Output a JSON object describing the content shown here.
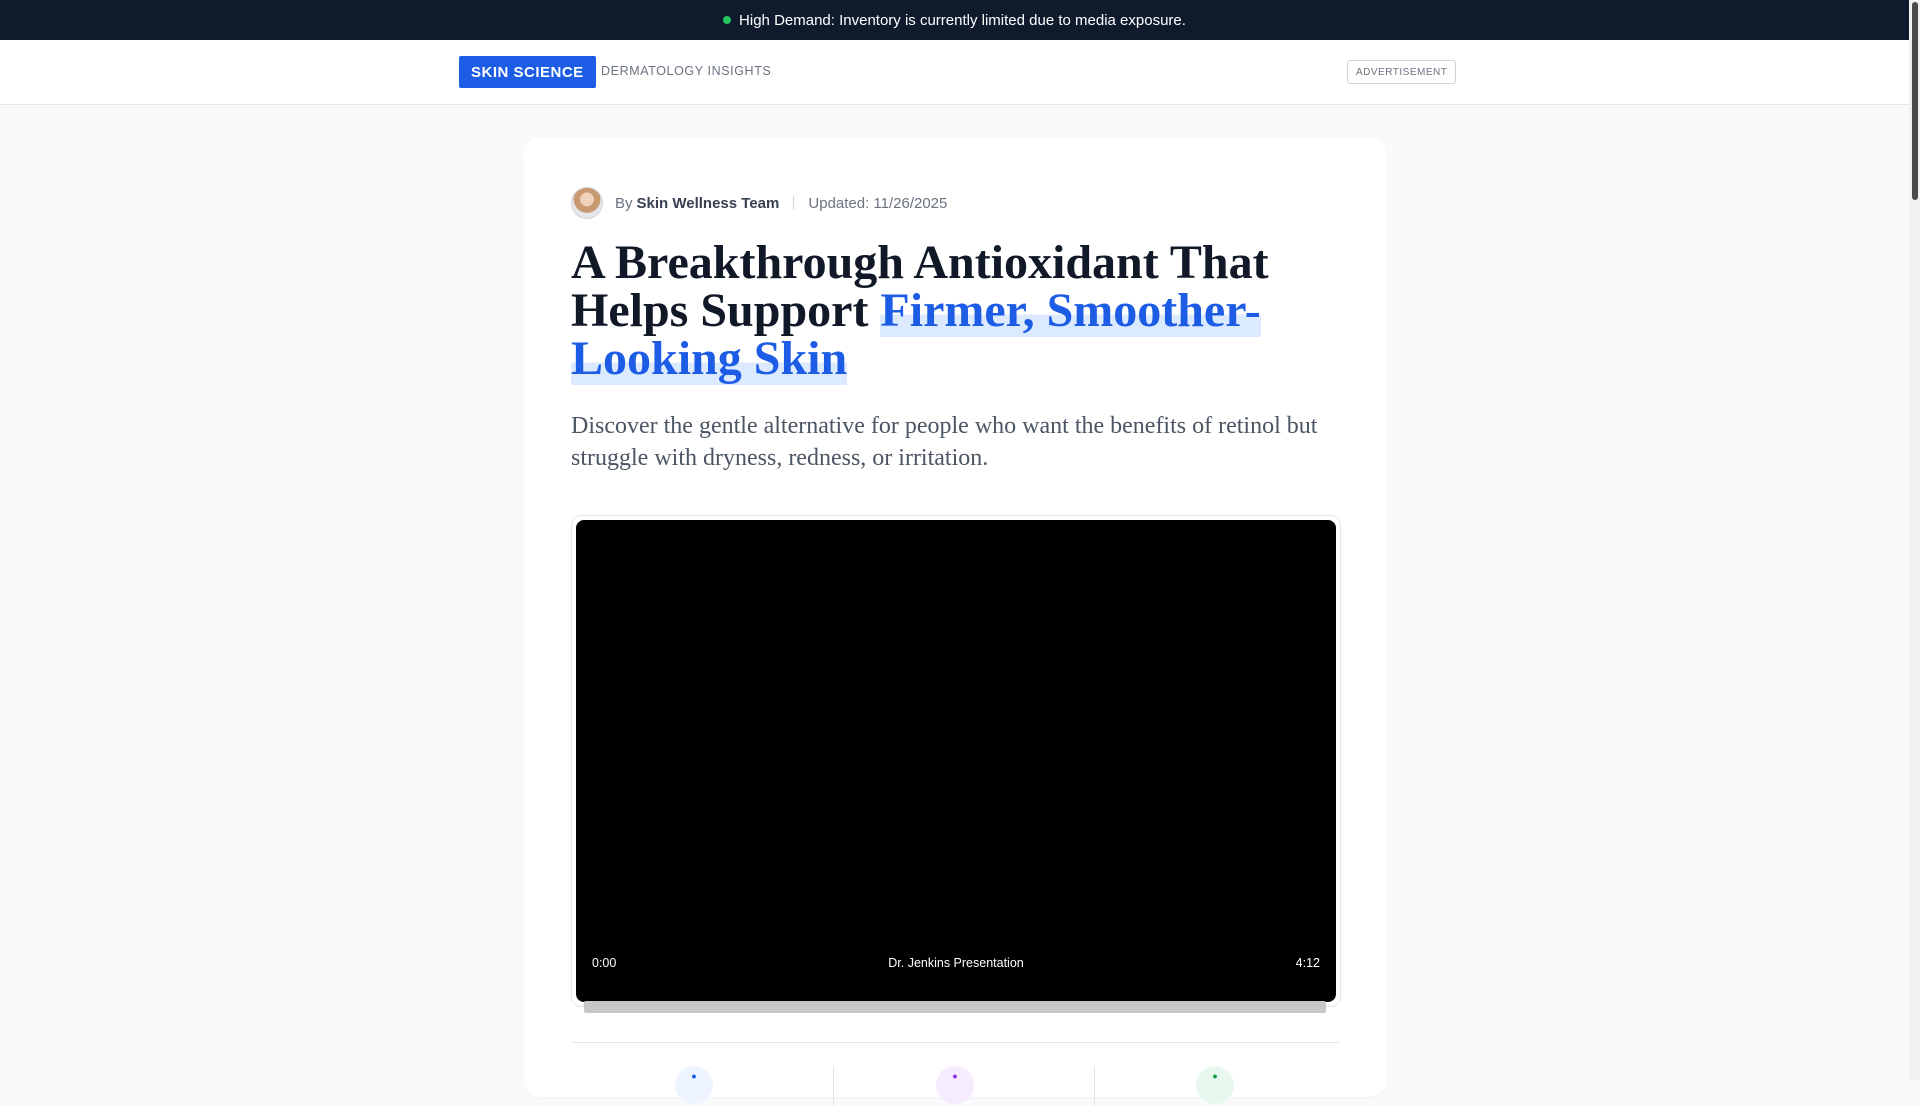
{
  "banner": {
    "text": "High Demand: Inventory is currently limited due to media exposure."
  },
  "header": {
    "brand": "SKIN SCIENCE",
    "tagline": "DERMATOLOGY INSIGHTS",
    "ad_label": "ADVERTISEMENT"
  },
  "article": {
    "by_prefix": "By",
    "author": "Skin Wellness Team",
    "updated": "Updated: 11/26/2025",
    "headline_plain": "A Breakthrough Antioxidant That Helps Support ",
    "headline_highlight": "Firmer, Smoother-Looking Skin",
    "subheadline": "Discover the gentle alternative for people who want the benefits of retinol but struggle with dryness, redness, or irritation."
  },
  "video": {
    "time_start": "0:00",
    "caption": "Dr. Jenkins Presentation",
    "time_end": "4:12"
  },
  "colors": {
    "accent": "#1d5ce5",
    "banner_bg": "#0f1b2d",
    "status_dot": "#22c55e"
  }
}
